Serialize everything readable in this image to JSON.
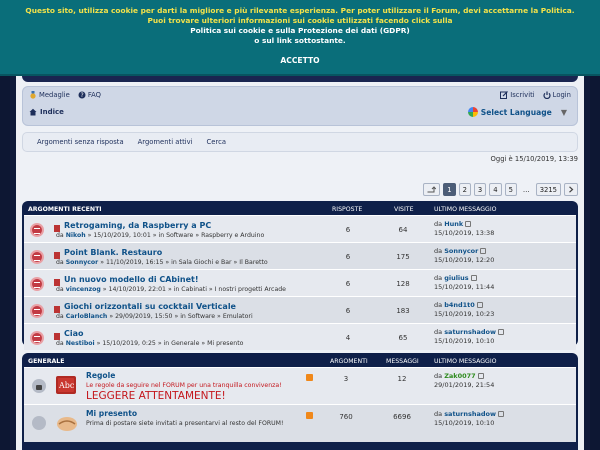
{
  "cookie": {
    "line1": "Questo sito, utilizza cookie per darti la migliore e più rilevante esperienza. Per poter utilizzare il Forum, devi accettarne la Politica.",
    "line2": "Puoi trovare ulteriori informazioni sui cookie utilizzati facendo click sulla",
    "line3": "Politica sui cookie e sulla Protezione dei dati (GDPR)",
    "line4": "o sul link sottostante.",
    "accept": "ACCETTO"
  },
  "nav": {
    "medaglie": "Medaglie",
    "faq": "FAQ",
    "iscriviti": "Iscriviti",
    "login": "Login",
    "indice": "Indice",
    "translate": "Select Language"
  },
  "quicklinks": [
    "Argomenti senza risposta",
    "Argomenti attivi",
    "Cerca"
  ],
  "date": "Oggi è 15/10/2019, 13:39",
  "pagination": [
    "1",
    "2",
    "3",
    "4",
    "5",
    "…",
    "3215"
  ],
  "colors": {
    "banner": "#0a6e7a",
    "navy": "#0f2049",
    "link": "#105289",
    "red": "#c4161c"
  },
  "recent": {
    "title": "ARGOMENTI RECENTI",
    "col_replies": "RISPOSTE",
    "col_views": "VISITE",
    "col_last": "ULTIMO MESSAGGIO",
    "rows": [
      {
        "title": "Retrogaming, da Raspberry a PC",
        "by": "da",
        "author": "Nikoh",
        "meta": "» 15/10/2019, 10:01 » in Software » Raspberry e Arduino",
        "replies": "6",
        "views": "64",
        "last_user": "Hunk",
        "last_date": "15/10/2019, 13:38"
      },
      {
        "title": "Point Blank. Restauro",
        "by": "da",
        "author": "Sonnycor",
        "meta": "» 11/10/2019, 16:15 » in Sala Giochi e Bar » Il Baretto",
        "replies": "6",
        "views": "175",
        "last_user": "Sonnycor",
        "last_date": "15/10/2019, 12:20"
      },
      {
        "title": "Un nuovo modello di CAbinet!",
        "by": "da",
        "author": "vincenzog",
        "meta": "» 14/10/2019, 22:01 » in Cabinati » I nostri progetti Arcade",
        "replies": "6",
        "views": "128",
        "last_user": "giulius",
        "last_date": "15/10/2019, 11:44"
      },
      {
        "title": "Giochi orizzontali su cocktail Verticale",
        "by": "da",
        "author": "CarloBlanch",
        "meta": "» 29/09/2019, 15:50 » in Software » Emulatori",
        "replies": "6",
        "views": "183",
        "last_user": "b4nd1t0",
        "last_date": "15/10/2019, 10:23"
      },
      {
        "title": "Ciao",
        "by": "da",
        "author": "Nestiboi",
        "meta": "» 15/10/2019, 0:25 » in Generale » Mi presento",
        "replies": "4",
        "views": "65",
        "last_user": "saturnshadow",
        "last_date": "15/10/2019, 10:10"
      }
    ]
  },
  "general": {
    "title": "GENERALE",
    "col_topics": "ARGOMENTI",
    "col_posts": "MESSAGGI",
    "col_last": "ULTIMO MESSAGGIO",
    "forums": [
      {
        "title": "Regole",
        "desc": "Le regole da seguire nel FORUM per una tranquilla convivenza!",
        "big": "LEGGERE ATTENTAMENTE!",
        "topics": "3",
        "posts": "12",
        "by": "da",
        "last_user": "Zak0077",
        "last_date": "29/01/2019, 21:54"
      },
      {
        "title": "Mi presento",
        "desc": "Prima di postare siete invitati a presentarvi al resto del FORUM!",
        "topics": "760",
        "posts": "6696",
        "by": "da",
        "last_user": "saturnshadow",
        "last_date": "15/10/2019, 10:10"
      }
    ]
  }
}
